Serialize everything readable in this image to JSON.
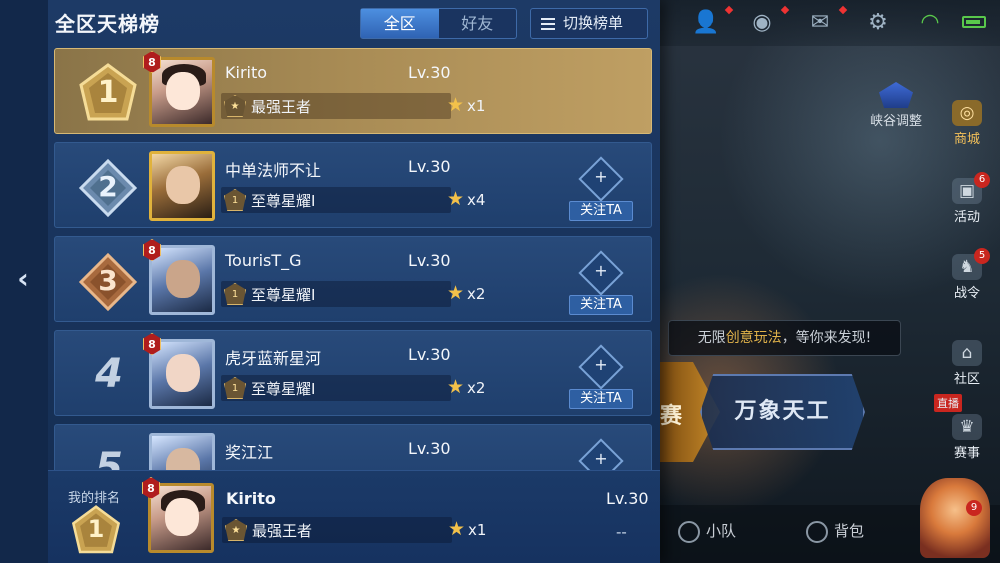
{
  "panel": {
    "title": "全区天梯榜",
    "tabs": [
      {
        "label": "全区",
        "active": true
      },
      {
        "label": "好友",
        "active": false
      }
    ],
    "switch_label": "切换榜单"
  },
  "rows": [
    {
      "rank": "1",
      "lvtag": "8",
      "name": "Kirito",
      "level": "Lv.30",
      "tier_icon": "",
      "tier": "最强王者",
      "stars": "x1",
      "follow": ""
    },
    {
      "rank": "2",
      "lvtag": "",
      "name": "中单法师不让",
      "level": "Lv.30",
      "tier_icon": "1",
      "tier": "至尊星耀I",
      "stars": "x4",
      "follow": "关注TA"
    },
    {
      "rank": "3",
      "lvtag": "8",
      "name": "TourisT_G",
      "level": "Lv.30",
      "tier_icon": "1",
      "tier": "至尊星耀I",
      "stars": "x2",
      "follow": "关注TA"
    },
    {
      "rank": "4",
      "lvtag": "8",
      "name": "虎牙蓝新星河",
      "level": "Lv.30",
      "tier_icon": "1",
      "tier": "至尊星耀I",
      "stars": "x2",
      "follow": "关注TA"
    },
    {
      "rank": "5",
      "lvtag": "",
      "name": "奖江江",
      "level": "Lv.30",
      "tier_icon": "",
      "tier": "",
      "stars": "",
      "follow": ""
    }
  ],
  "my_rank": {
    "label": "我的排名",
    "rank": "1",
    "lvtag": "8",
    "name": "Kirito",
    "level": "Lv.30",
    "tier": "最强王者",
    "stars": "x1",
    "extra": "--"
  },
  "right": {
    "peak_label": "峡谷调整",
    "nav": [
      {
        "label": "商城",
        "badge": ""
      },
      {
        "label": "活动",
        "badge": "6"
      },
      {
        "label": "战令",
        "badge": "5"
      },
      {
        "label": "社区",
        "badge": ""
      },
      {
        "label": "赛事",
        "badge": "直播"
      }
    ],
    "hint_pre": "无限",
    "hint_hl": "创意玩法",
    "hint_post": "，等你来发现!",
    "mode_left": "赛",
    "mode_main": "万象天工",
    "bottom": [
      {
        "label": "小队"
      },
      {
        "label": "背包"
      }
    ],
    "hero_badge": "9"
  }
}
